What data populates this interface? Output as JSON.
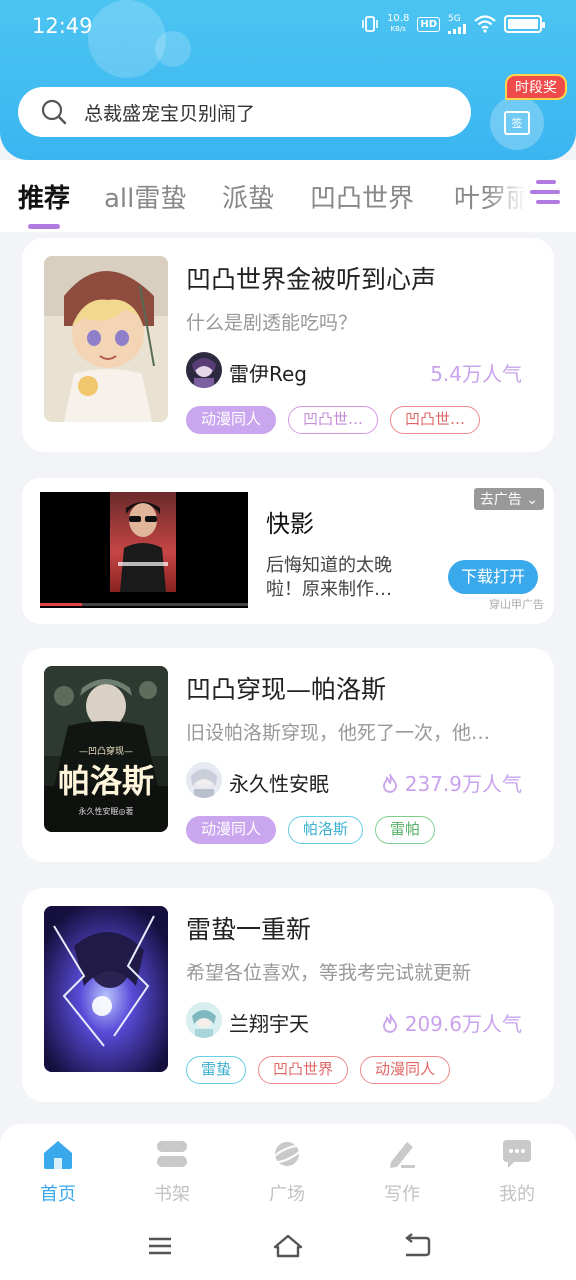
{
  "status_bar": {
    "time": "12:49",
    "net_speed_top": "10.8",
    "net_speed_unit": "KB/s",
    "hd": "HD",
    "network": "5G"
  },
  "search": {
    "placeholder": "总裁盛宠宝贝别闹了"
  },
  "signin": {
    "badge": "时段奖",
    "icon_label": "签"
  },
  "tabs": [
    {
      "label": "推荐",
      "active": true
    },
    {
      "label": "all雷蛰",
      "active": false
    },
    {
      "label": "派蛰",
      "active": false
    },
    {
      "label": "凹凸世界",
      "active": false
    },
    {
      "label": "叶罗丽",
      "active": false
    }
  ],
  "books": [
    {
      "title": "凹凸世界金被听到心声",
      "desc": "什么是剧透能吃吗？",
      "author": "雷伊Reg",
      "popularity": "5.4万人气",
      "hot": false,
      "tags": [
        {
          "label": "动漫同人",
          "style": "purple"
        },
        {
          "label": "凹凸世…",
          "style": "pink"
        },
        {
          "label": "凹凸世…",
          "style": "red"
        }
      ]
    },
    {
      "title": "凹凸穿现—帕洛斯",
      "desc": "旧设帕洛斯穿现，他死了一次，他…",
      "author": "永久性安眠",
      "popularity": "237.9万人气",
      "hot": true,
      "tags": [
        {
          "label": "动漫同人",
          "style": "purple"
        },
        {
          "label": "帕洛斯",
          "style": "cyan"
        },
        {
          "label": "雷帕",
          "style": "green"
        }
      ]
    },
    {
      "title": "雷蛰一重新",
      "desc": "希望各位喜欢，等我考完试就更新",
      "author": "兰翔宇天",
      "popularity": "209.6万人气",
      "hot": true,
      "tags": [
        {
          "label": "雷蛰",
          "style": "cyan"
        },
        {
          "label": "凹凸世界",
          "style": "red"
        },
        {
          "label": "动漫同人",
          "style": "red"
        }
      ]
    }
  ],
  "cover_text": {
    "sub": "—凹凸穿现—",
    "main": "帕洛斯",
    "author": "永久性安眠◎著"
  },
  "ad": {
    "title": "快影",
    "desc": "后悔知道的太晚啦！原来制作…",
    "close_label": "去广告 ⌄",
    "button": "下载打开",
    "source": "穿山甲广告"
  },
  "nav": [
    {
      "label": "首页",
      "icon": "home-icon",
      "active": true
    },
    {
      "label": "书架",
      "icon": "bookshelf-icon",
      "active": false
    },
    {
      "label": "广场",
      "icon": "planet-icon",
      "active": false
    },
    {
      "label": "写作",
      "icon": "pen-icon",
      "active": false
    },
    {
      "label": "我的",
      "icon": "chat-bubble-icon",
      "active": false
    }
  ],
  "colors": {
    "accent": "#3aa9ec",
    "header": "#42bdf1",
    "tab_indicator": "#b07be0",
    "popularity": "#c9a3ec"
  }
}
